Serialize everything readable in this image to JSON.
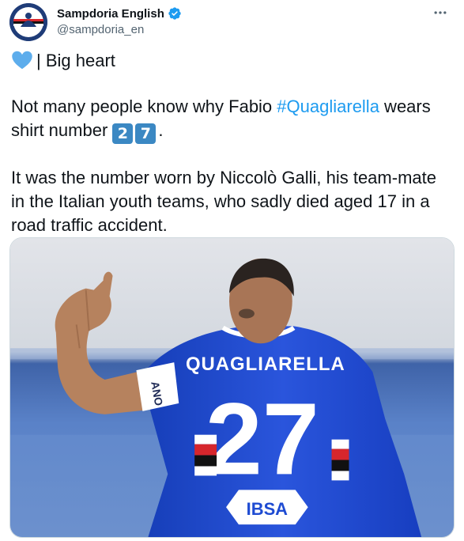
{
  "author": {
    "display_name": "Sampdoria English",
    "handle": "@sampdoria_en"
  },
  "tweet": {
    "line1_text": "| Big heart",
    "p2_before": "Not many people know why Fabio ",
    "p2_hashtag": "#Quagliarella",
    "p2_after1": " wears shirt number ",
    "p2_digit1": "2",
    "p2_digit2": "7",
    "p2_end": ".",
    "p3": "It was the number worn by Niccolò Galli, his team-mate in the Italian youth teams, who sadly died aged 17 in a road traffic accident."
  },
  "media": {
    "shirt_name": "QUAGLIARELLA",
    "shirt_number": "27",
    "sponsor": "IBSA",
    "armband_text": "ANO"
  },
  "icons": {
    "heart": "blue-heart-icon",
    "verified": "verified-badge-icon",
    "more": "more-options-icon"
  },
  "colors": {
    "hashtag": "#1d9bf0",
    "verified": "#1d9bf0",
    "keycap": "#3b88c3",
    "heart": "#5dadec",
    "jersey": "#1e4bd2"
  }
}
